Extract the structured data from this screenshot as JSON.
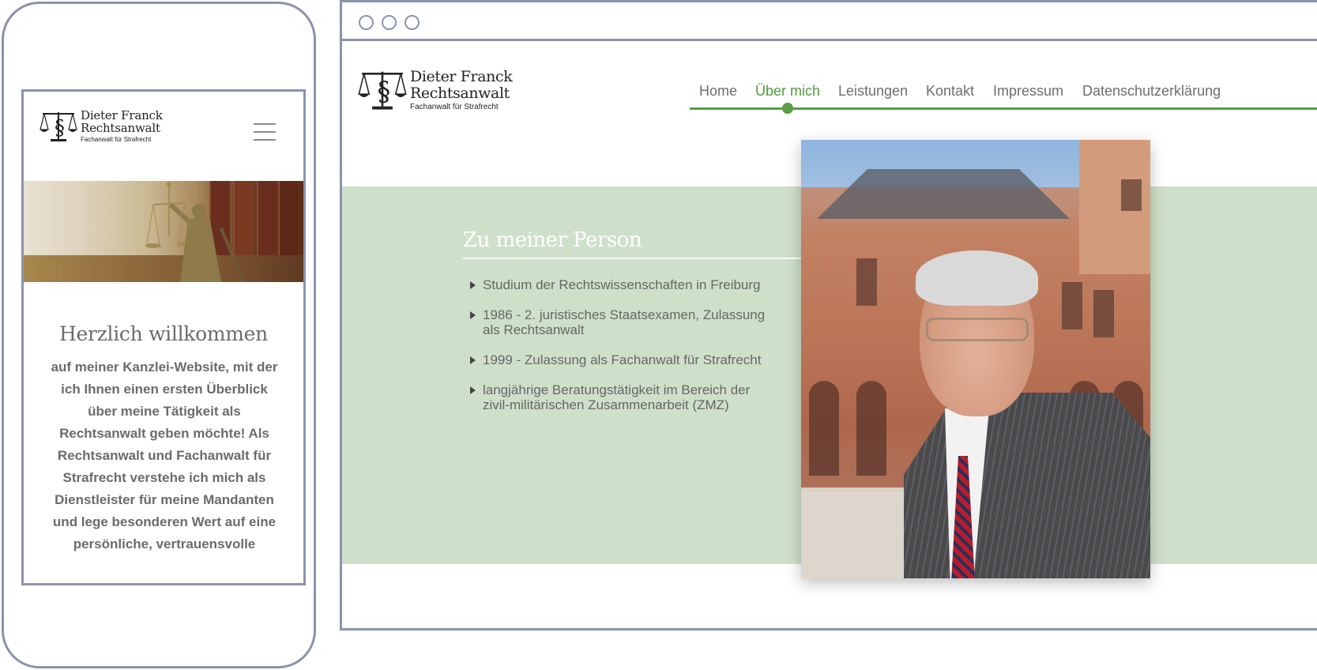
{
  "mobile": {
    "logo": {
      "name_line1": "Dieter Franck",
      "name_line2": "Rechtsanwalt",
      "subtitle": "Fachanwalt für Strafrecht"
    },
    "menu_icon": "hamburger-icon",
    "welcome_title": "Herzlich willkommen",
    "welcome_text": "auf meiner Kanzlei-Website, mit der ich Ihnen einen ersten Überblick über meine Tätigkeit als Rechtsanwalt geben möchte! Als Rechtsanwalt und Fachanwalt für Strafrecht verstehe ich mich als Dienstleister für meine Mandanten und lege besonderen Wert auf eine persönliche, vertrauensvolle"
  },
  "desktop": {
    "logo": {
      "name_line1": "Dieter Franck",
      "name_line2": "Rechtsanwalt",
      "subtitle": "Fachanwalt für Strafrecht"
    },
    "nav": {
      "items": [
        "Home",
        "Über mich",
        "Leistungen",
        "Kontakt",
        "Impressum",
        "Datenschutzerklärung"
      ],
      "active": "Über mich"
    },
    "section_title": "Zu meiner Person",
    "bullets": [
      "Studium der Rechtswissenschaften in Freiburg",
      "1986 - 2. juristisches Staatsexamen, Zulassung als Rechtsanwalt",
      "1999 - Zulassung als Fachanwalt für Strafrecht",
      "langjährige Beratungstätigkeit im Bereich der zivil-militärischen Zusammenarbeit (ZMZ)"
    ]
  },
  "colors": {
    "accent_green": "#5a9e46",
    "band_green": "#cfe0ca",
    "frame": "#8a93ae"
  }
}
